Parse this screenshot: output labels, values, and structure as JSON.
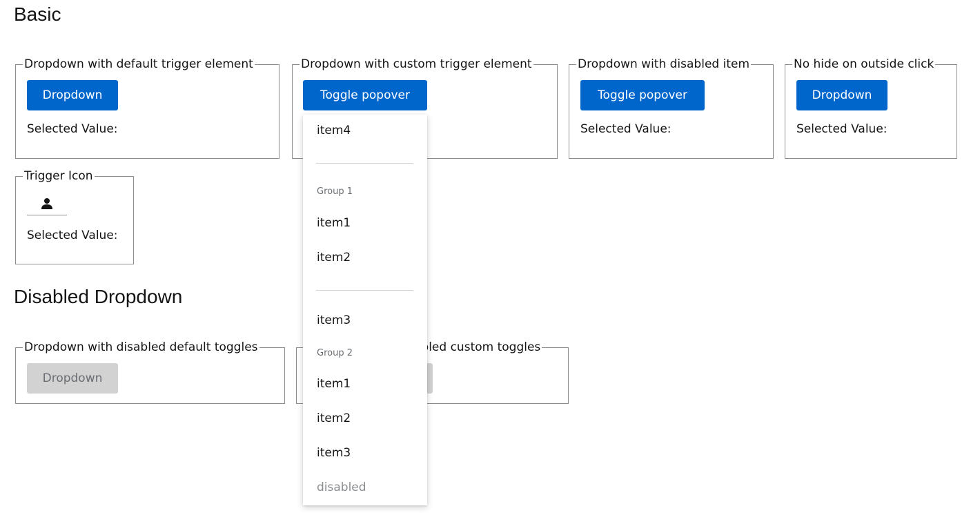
{
  "sections": {
    "basic_title": "Basic",
    "disabled_title": "Disabled Dropdown"
  },
  "basic": {
    "default_trigger": {
      "legend": "Dropdown with default trigger element",
      "button": "Dropdown",
      "selected": "Selected Value:"
    },
    "custom_trigger": {
      "legend": "Dropdown with custom trigger element",
      "button": "Toggle popover"
    },
    "disabled_item": {
      "legend": "Dropdown with disabled item",
      "button": "Toggle popover",
      "selected": "Selected Value:"
    },
    "no_hide": {
      "legend": "No hide on outside click",
      "button": "Dropdown",
      "selected": "Selected Value:"
    },
    "trigger_icon": {
      "legend": "Trigger Icon",
      "icon": "user-icon",
      "selected": "Selected Value:"
    }
  },
  "disabled": {
    "default_toggles": {
      "legend": "Dropdown with disabled default toggles",
      "button": "Dropdown"
    },
    "custom_toggles": {
      "legend_visible": "abled custom toggles"
    }
  },
  "menu": {
    "item4": "item4",
    "group1": "Group 1",
    "g1_item1": "item1",
    "g1_item2": "item2",
    "item3": "item3",
    "group2": "Group 2",
    "g2_item1": "item1",
    "g2_item2": "item2",
    "g2_item3": "item3",
    "disabled_item": "disabled"
  },
  "colors": {
    "primary": "#0066cc",
    "disabled_bg": "#d2d2d2",
    "border": "#8a8d90"
  }
}
